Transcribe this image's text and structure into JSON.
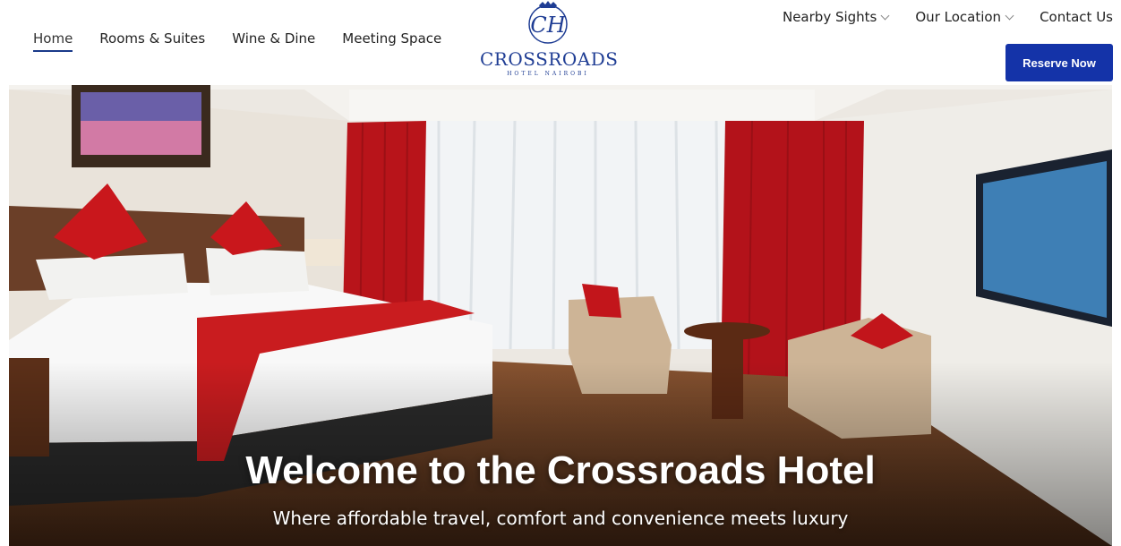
{
  "nav": {
    "left": [
      {
        "label": "Home",
        "active": true
      },
      {
        "label": "Rooms & Suites"
      },
      {
        "label": "Wine & Dine"
      },
      {
        "label": "Meeting Space"
      }
    ],
    "right": [
      {
        "label": "Nearby Sights",
        "dropdown": true
      },
      {
        "label": "Our Location",
        "dropdown": true
      },
      {
        "label": "Contact Us",
        "dropdown": false
      }
    ],
    "reserve_label": "Reserve Now"
  },
  "logo": {
    "monogram": "CH",
    "name": "CROSSROADS",
    "sub": "HOTEL NAIROBI"
  },
  "hero": {
    "title": "Welcome to the Crossroads Hotel",
    "subtitle": "Where affordable travel, comfort and convenience meets luxury"
  },
  "colors": {
    "brand": "#1f3d94",
    "button": "#1433a8",
    "curtain": "#b8141a",
    "floor": "#6b3f22"
  }
}
